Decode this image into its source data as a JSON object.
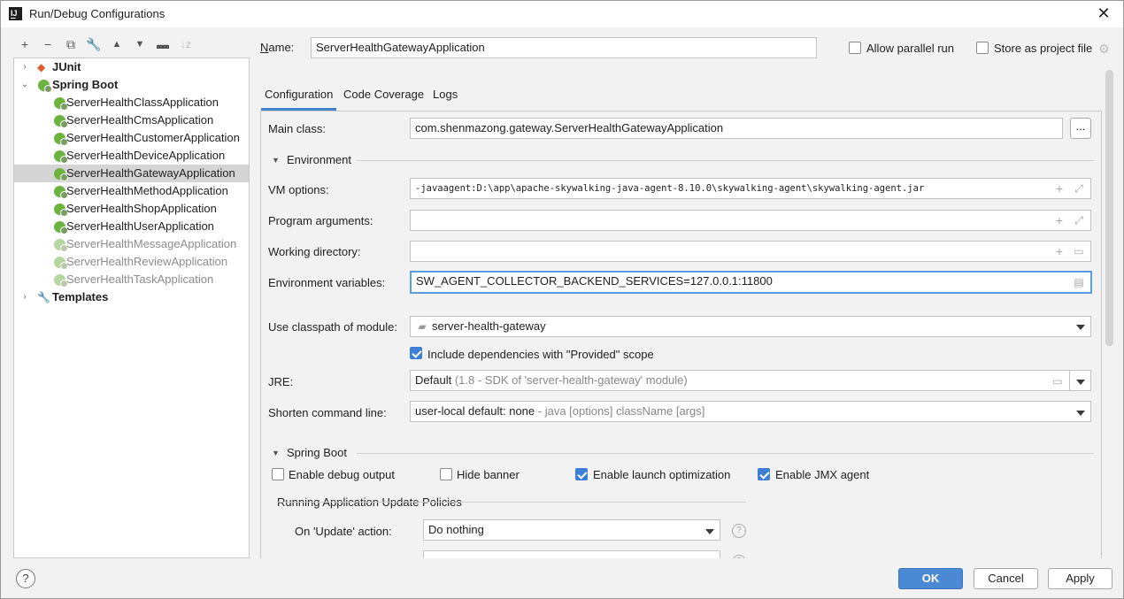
{
  "window": {
    "title": "Run/Debug Configurations"
  },
  "toolbar": {
    "icons": [
      "plus-icon",
      "minus-icon",
      "copy-icon",
      "wrench-icon",
      "arrow-up-icon",
      "arrow-down-icon",
      "folder-add-icon",
      "sort-icon"
    ]
  },
  "tree": {
    "junit": "JUnit",
    "spring_boot": "Spring Boot",
    "apps": [
      {
        "label": "ServerHealthClassApplication",
        "state": "normal"
      },
      {
        "label": "ServerHealthCmsApplication",
        "state": "normal"
      },
      {
        "label": "ServerHealthCustomerApplication",
        "state": "normal"
      },
      {
        "label": "ServerHealthDeviceApplication",
        "state": "normal"
      },
      {
        "label": "ServerHealthGatewayApplication",
        "state": "selected"
      },
      {
        "label": "ServerHealthMethodApplication",
        "state": "normal"
      },
      {
        "label": "ServerHealthShopApplication",
        "state": "normal"
      },
      {
        "label": "ServerHealthUserApplication",
        "state": "normal"
      },
      {
        "label": "ServerHealthMessageApplication",
        "state": "muted"
      },
      {
        "label": "ServerHealthReviewApplication",
        "state": "muted"
      },
      {
        "label": "ServerHealthTaskApplication",
        "state": "muted"
      }
    ],
    "templates": "Templates"
  },
  "header": {
    "name_label": "Name:",
    "name_value": "ServerHealthGatewayApplication",
    "allow_parallel": "Allow parallel run",
    "store_project": "Store as project file"
  },
  "tabs": {
    "configuration": "Configuration",
    "coverage": "Code Coverage",
    "logs": "Logs"
  },
  "form": {
    "main_class_label": "Main class:",
    "main_class_value": "com.shenmazong.gateway.ServerHealthGatewayApplication",
    "browse_label": "...",
    "environment_section": "Environment",
    "vm_options_label": "VM options:",
    "vm_options_value": "-javaagent:D:\\app\\apache-skywalking-java-agent-8.10.0\\skywalking-agent\\skywalking-agent.jar",
    "program_args_label": "Program arguments:",
    "program_args_value": "",
    "working_dir_label": "Working directory:",
    "working_dir_value": "",
    "env_vars_label": "Environment variables:",
    "env_vars_value": "SW_AGENT_COLLECTOR_BACKEND_SERVICES=127.0.0.1:11800",
    "classpath_label": "Use classpath of module:",
    "classpath_value": "server-health-gateway",
    "include_deps": "Include dependencies with \"Provided\" scope",
    "jre_label": "JRE:",
    "jre_value": "Default",
    "jre_hint": "(1.8 - SDK of 'server-health-gateway' module)",
    "shorten_label": "Shorten command line:",
    "shorten_value": "user-local default: none",
    "shorten_hint": "- java [options] className [args]",
    "spring_boot_section": "Spring Boot",
    "debug_output": "Enable debug output",
    "hide_banner": "Hide banner",
    "launch_opt": "Enable launch optimization",
    "jmx_agent": "Enable JMX agent",
    "update_policies": "Running Application Update Policies",
    "on_update_label": "On 'Update' action:",
    "on_update_value": "Do nothing"
  },
  "checks": {
    "allow_parallel": false,
    "store_project": false,
    "include_deps": true,
    "debug_output": false,
    "hide_banner": false,
    "launch_opt": true,
    "jmx_agent": true
  },
  "buttons": {
    "ok": "OK",
    "cancel": "Cancel",
    "apply": "Apply",
    "help": "?"
  },
  "colors": {
    "accent": "#4a8ad4",
    "selection": "#d5d5d5",
    "spring": "#6db33f"
  }
}
